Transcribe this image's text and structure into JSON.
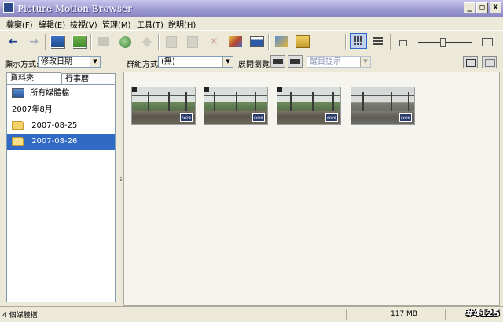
{
  "window": {
    "title": "Picture Motion Browser",
    "min_label": "_",
    "max_label": "□",
    "close_label": "X"
  },
  "menu": [
    {
      "label": "檔案(F)"
    },
    {
      "label": "編輯(E)"
    },
    {
      "label": "檢視(V)"
    },
    {
      "label": "管理(M)"
    },
    {
      "label": "工具(T)"
    },
    {
      "label": "說明(H)"
    }
  ],
  "toolbar": {
    "back_glyph": "←",
    "forward_glyph": "→",
    "icons": [
      "import-icon",
      "export-icon",
      "print-icon",
      "globe-icon",
      "upload-icon",
      "copy-icon",
      "paste-icon",
      "delete-icon",
      "edit-icon",
      "slideshow-icon",
      "magic-icon",
      "move-icon",
      "thumbnail-view-icon",
      "detail-view-icon",
      "zoom-small-icon",
      "zoom-large-icon"
    ]
  },
  "left": {
    "display_mode_label": "顯示方式:",
    "display_mode_value": "修改日期",
    "tabs": [
      {
        "label": "資料夾"
      },
      {
        "label": "行事曆"
      }
    ],
    "all_media": "所有媒體檔",
    "group_header": "2007年8月",
    "folders": [
      {
        "label": "2007-08-25",
        "selected": false
      },
      {
        "label": "2007-08-26",
        "selected": true
      }
    ]
  },
  "groupbar": {
    "group_label": "群組方式:",
    "group_value": "(無)",
    "expand_label": "展開瀏覽:",
    "hint_value": "醒目提示"
  },
  "thumbnails": [
    {
      "badge": "AVCHD",
      "style": "color"
    },
    {
      "badge": "AVCHD",
      "style": "color"
    },
    {
      "badge": "AVCHD",
      "style": "color"
    },
    {
      "badge": "AVCHD",
      "style": "gray"
    }
  ],
  "status": {
    "count": "4 個媒體檔",
    "size": "117 MB",
    "watermark": "#4125"
  },
  "colors": {
    "selection": "#316ac5",
    "titlebar": "#9c98d0",
    "chrome": "#ece9d8"
  }
}
